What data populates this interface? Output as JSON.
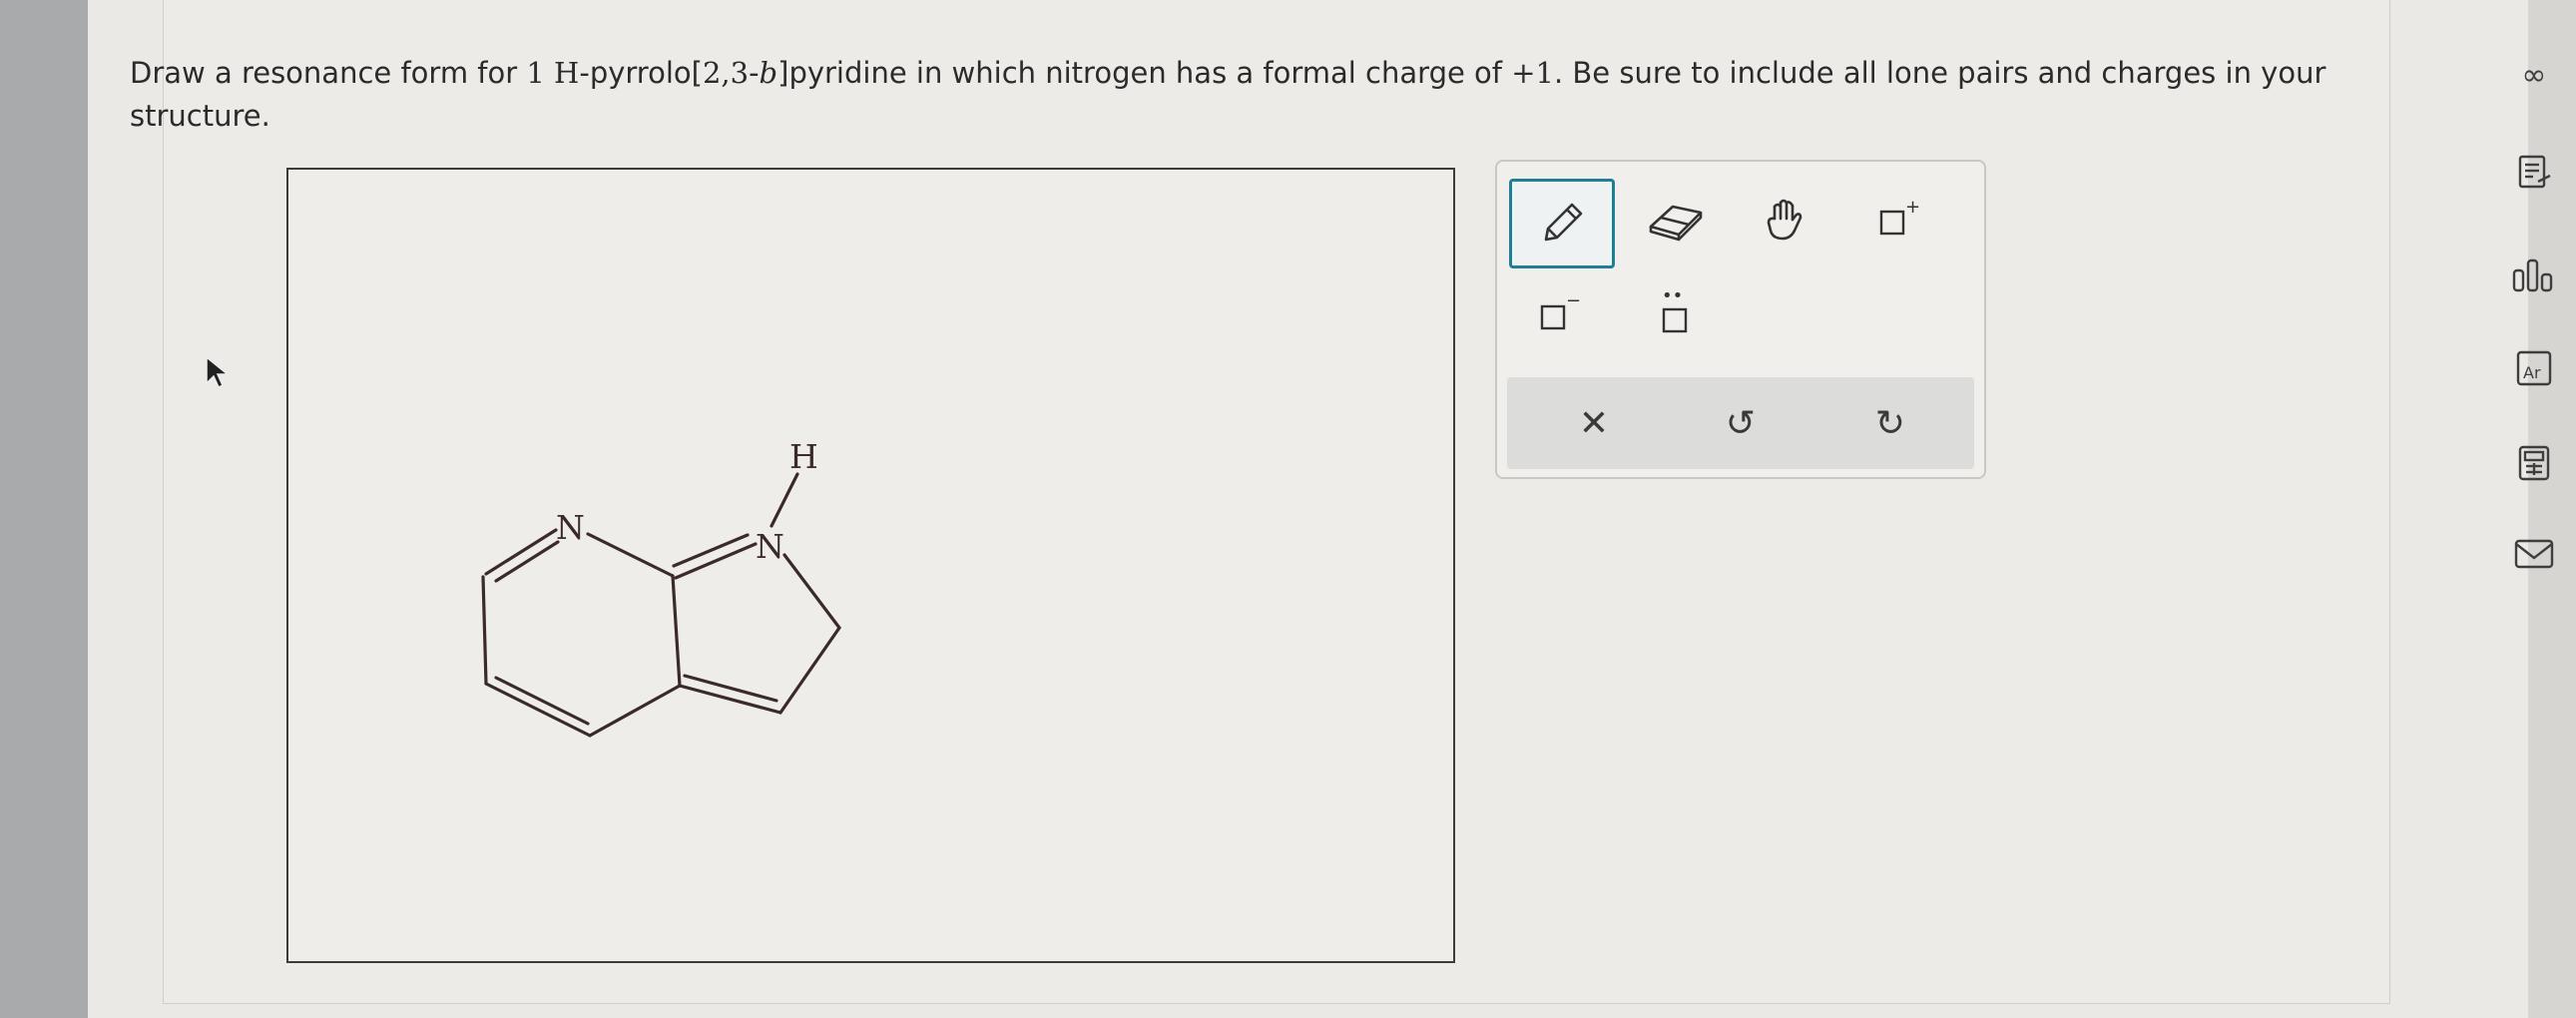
{
  "question": {
    "part1": "Draw a resonance form for ",
    "compound_locant": "1 H",
    "part2": "-pyrrolo[",
    "ring_fusion_numbers": "2,3",
    "part3": "-",
    "ring_fusion_letter": "b",
    "part4": "]pyridine in which nitrogen has a formal charge of ",
    "charge_value": "+1",
    "part5": ". Be sure to include all lone pairs and charges in your structure."
  },
  "molecule": {
    "atom_labels": {
      "pyridine_n": "N",
      "pyrrole_n": "N",
      "hydrogen": "H"
    }
  },
  "toolbar": {
    "positive_charge_symbol": "+",
    "negative_charge_symbol": "−",
    "lone_pair_symbol": "••",
    "clear_symbol": "✕",
    "undo_symbol": "↺",
    "redo_symbol": "↻"
  },
  "sidebar": {
    "infinity_symbol": "∞",
    "periodic_table_symbol": "Ar"
  },
  "colors": {
    "selected_tool_border": "#1f7f96",
    "canvas_border": "#3c3c3c",
    "bond_color": "#3a2a2a"
  }
}
